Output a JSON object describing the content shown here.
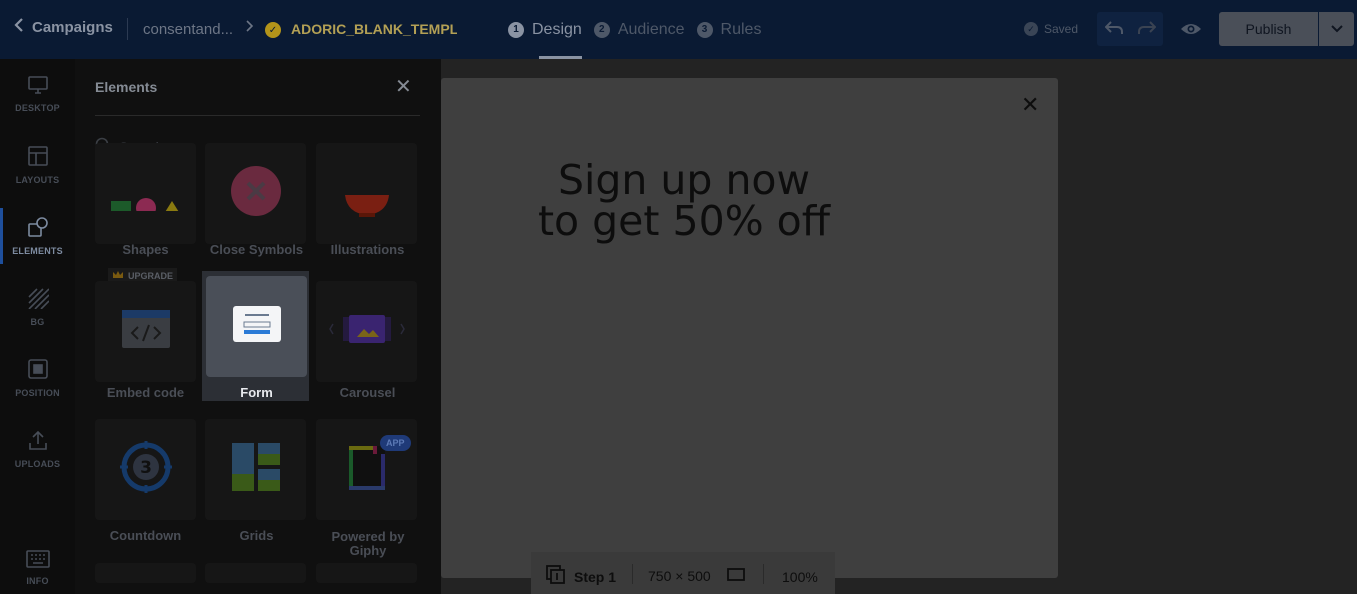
{
  "topbar": {
    "back_label": "Campaigns",
    "project": "consentand...",
    "campaign": "ADORIC_BLANK_TEMPL",
    "steps": [
      {
        "num": "1",
        "label": "Design"
      },
      {
        "num": "2",
        "label": "Audience"
      },
      {
        "num": "3",
        "label": "Rules"
      }
    ],
    "active_step": "Design",
    "saved_label": "Saved",
    "publish_label": "Publish"
  },
  "rail": {
    "items": [
      {
        "label": "DESKTOP",
        "icon": "monitor-icon"
      },
      {
        "label": "LAYOUTS",
        "icon": "layout-icon"
      },
      {
        "label": "ELEMENTS",
        "icon": "shapes-icon"
      },
      {
        "label": "BG",
        "icon": "stripes-icon"
      },
      {
        "label": "POSITION",
        "icon": "position-icon"
      },
      {
        "label": "UPLOADS",
        "icon": "upload-icon"
      },
      {
        "label": "INFO",
        "icon": "keyboard-icon"
      }
    ],
    "active": "ELEMENTS"
  },
  "panel": {
    "title": "Elements",
    "search_placeholder": "Search",
    "tiles": [
      {
        "label": "Shapes",
        "icon": "shapes-icon"
      },
      {
        "label": "Close Symbols",
        "icon": "close-symbol-icon"
      },
      {
        "label": "Illustrations",
        "icon": "bowl-illustration-icon"
      },
      {
        "label": "Embed code",
        "icon": "code-window-icon"
      },
      {
        "label": "Form",
        "icon": "form-icon"
      },
      {
        "label": "Carousel",
        "icon": "carousel-icon"
      },
      {
        "label": "Countdown",
        "icon": "countdown-icon"
      },
      {
        "label": "Grids",
        "icon": "grid-images-icon"
      },
      {
        "label": "Powered by Giphy",
        "icon": "giphy-icon"
      }
    ],
    "selected": "Form",
    "upgrade_badge": "UPGRADE",
    "app_badge": "APP",
    "countdown_digit": "3"
  },
  "canvas": {
    "headline_line1": "Sign up now",
    "headline_line2": "to get 50% off"
  },
  "bottombar": {
    "step_label": "Step 1",
    "size_label": "750 × 500",
    "zoom_label": "100%"
  },
  "colors": {
    "topbar_bg": "#0a1a33",
    "accent_blue": "#1e4f9c",
    "canvas_bg": "#3f3f3f",
    "panel_bg": "#101010"
  }
}
